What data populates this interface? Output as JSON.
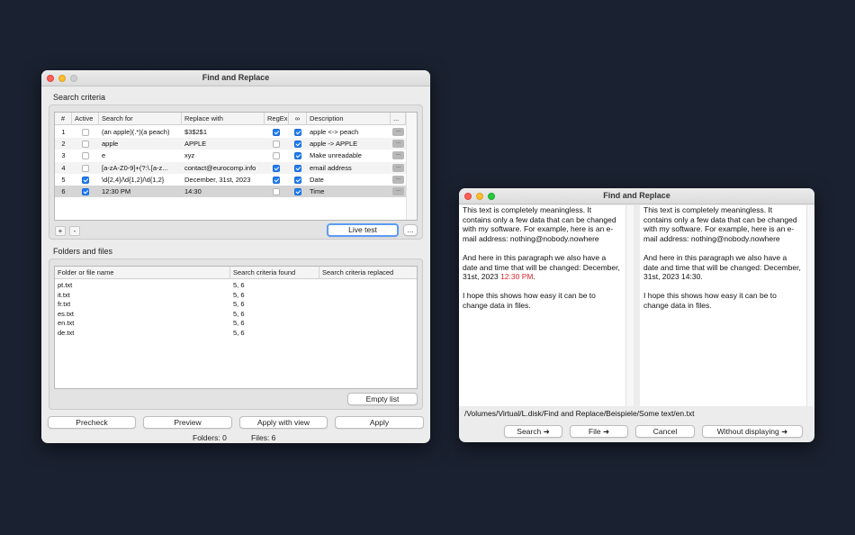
{
  "colors": {
    "accent": "#1f7cf5",
    "highlight": "#e0242a",
    "desktop": "#1a2130"
  },
  "left_window": {
    "title": "Find and Replace",
    "search_section_label": "Search criteria",
    "criteria_columns": [
      "#",
      "Active",
      "Search for",
      "Replace with",
      "RegEx",
      "∞",
      "Description",
      "..."
    ],
    "criteria_rows": [
      {
        "n": "1",
        "active": false,
        "search": "(an apple)(.*)(a peach)",
        "replace": "$3$2$1",
        "regex": true,
        "link": true,
        "desc": "apple <-> peach",
        "more": "..."
      },
      {
        "n": "2",
        "active": false,
        "search": "apple",
        "replace": "APPLE",
        "regex": false,
        "link": true,
        "desc": "apple -> APPLE",
        "more": "..."
      },
      {
        "n": "3",
        "active": false,
        "search": "e",
        "replace": " xyz",
        "regex": false,
        "link": true,
        "desc": "Make unreadable",
        "more": "..."
      },
      {
        "n": "4",
        "active": false,
        "search": "[a-zA-Z0-9]+(?:\\.[a-z...",
        "replace": "contact@eurocomp.info",
        "regex": true,
        "link": true,
        "desc": "email address",
        "more": "..."
      },
      {
        "n": "5",
        "active": true,
        "search": "\\d{2,4}/\\d{1,2}/\\d{1,2}",
        "replace": "December, 31st, 2023",
        "regex": true,
        "link": true,
        "desc": "Date",
        "more": "..."
      },
      {
        "n": "6",
        "active": true,
        "search": "12:30 PM",
        "replace": "14:30",
        "regex": false,
        "link": true,
        "desc": "Time",
        "more": "..."
      }
    ],
    "add_label": "+",
    "remove_label": "-",
    "live_test_label": "Live test",
    "more_label": "...",
    "folders_section_label": "Folders and files",
    "file_columns": [
      "Folder or file name",
      "Search criteria found",
      "Search criteria replaced"
    ],
    "file_rows": [
      {
        "name": "pt.txt",
        "found": "5, 6",
        "replaced": ""
      },
      {
        "name": "it.txt",
        "found": "5, 6",
        "replaced": ""
      },
      {
        "name": "fr.txt",
        "found": "5, 6",
        "replaced": ""
      },
      {
        "name": "es.txt",
        "found": "5, 6",
        "replaced": ""
      },
      {
        "name": "en.txt",
        "found": "5, 6",
        "replaced": ""
      },
      {
        "name": "de.txt",
        "found": "5, 6",
        "replaced": ""
      }
    ],
    "empty_list_label": "Empty list",
    "precheck_label": "Precheck",
    "preview_label": "Preview",
    "apply_with_view_label": "Apply with view",
    "apply_label": "Apply",
    "folders_status": "Folders:  0",
    "files_status": "Files: 6"
  },
  "right_window": {
    "title": "Find and Replace",
    "original": {
      "p1": "This text is completely meaningless. It contains only a few data that can be changed with my software. For example, here is an e-mail address: nothing@nobody.nowhere",
      "p2_before": "And here in this paragraph we also have a date and time that will be changed: December, 31st, 2023 ",
      "p2_highlight": "12:30 PM",
      "p2_after": ".",
      "p3": "I hope this shows how easy it can be to change data in files."
    },
    "replaced": {
      "p1": "This text is completely meaningless. It contains only a few data that can be changed with my software. For example, here is an e-mail address: nothing@nobody.nowhere",
      "p2": "And here in this paragraph we also have a date and time that will be changed: December, 31st, 2023 14:30.",
      "p3": "I hope this shows how easy it can be to change data in files."
    },
    "path": "/Volumes/Virtual/L.disk/Find and Replace/Beispiele/Some text/en.txt",
    "search_label": "Search ➜",
    "file_label": "File ➜",
    "cancel_label": "Cancel",
    "without_display_label": "Without displaying ➜"
  }
}
